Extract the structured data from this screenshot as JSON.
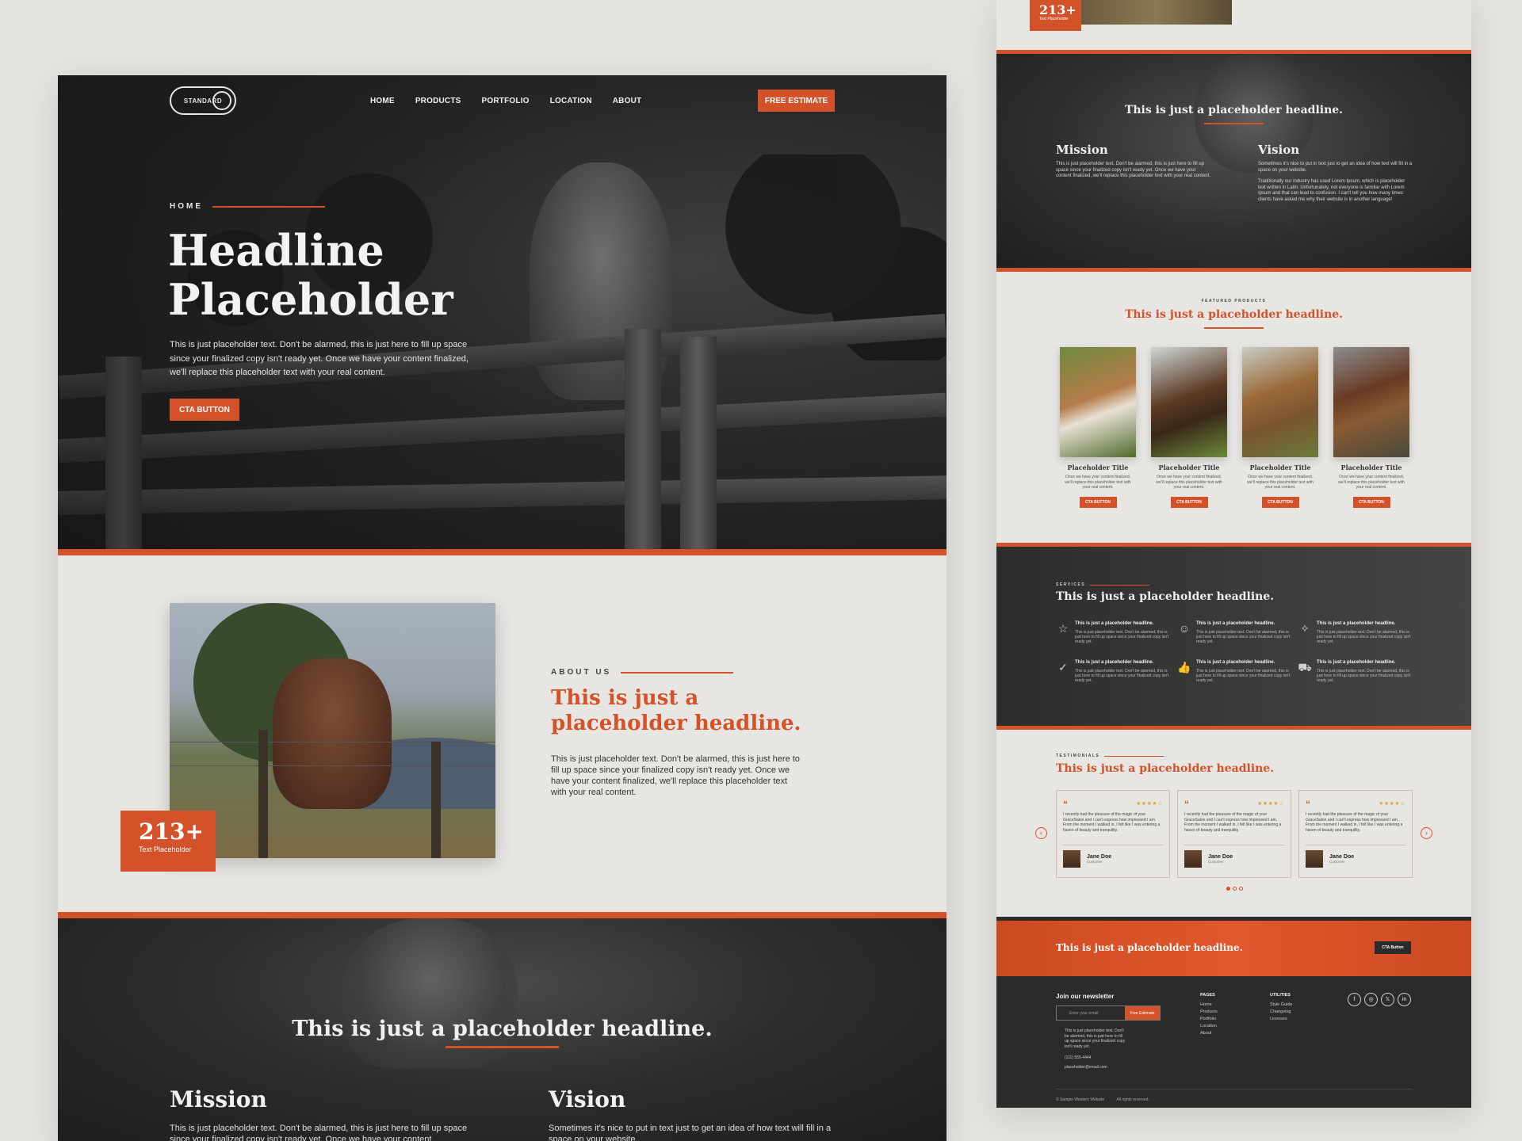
{
  "brand": {
    "logo_text": "STANDARD"
  },
  "nav": {
    "items": [
      "HOME",
      "PRODUCTS",
      "PORTFOLIO",
      "LOCATION",
      "ABOUT"
    ],
    "estimate_label": "FREE ESTIMATE"
  },
  "hero": {
    "eyebrow": "HOME",
    "headline_1": "Headline",
    "headline_2": "Placeholder",
    "body": "This is just placeholder text. Don't be alarmed, this is just here to fill up space since your finalized copy isn't ready yet. Once we have your content finalized, we'll replace this placeholder text with your real content.",
    "cta": "CTA BUTTON"
  },
  "about": {
    "eyebrow": "ABOUT US",
    "headline": "This is just a placeholder headline.",
    "body": "This is just placeholder text. Don't be alarmed, this is just here to fill up space since your finalized copy isn't ready yet. Once we have your content finalized, we'll replace this placeholder text with your real content.",
    "stat_value": "213+",
    "stat_label": "Text Placeholder"
  },
  "mission_vision": {
    "headline": "This is just a placeholder headline.",
    "mission_title": "Mission",
    "mission_text": "This is just placeholder text. Don't be alarmed, this is just here to fill up space since your finalized copy isn't ready yet. Once we have your content",
    "vision_title": "Vision",
    "vision_text": "Sometimes it's nice to put in text just to get an idea of how text will fill in a space on your website."
  },
  "right_page": {
    "stat_value": "213+",
    "stat_label": "Text Placeholder",
    "mv": {
      "headline": "This is just a placeholder headline.",
      "mission_title": "Mission",
      "mission_text": "This is just placeholder text. Don't be alarmed, this is just here to fill up space since your finalized copy isn't ready yet. Once we have your content finalized, we'll replace this placeholder text with your real content.",
      "vision_title": "Vision",
      "vision_text_1": "Sometimes it's nice to put in text just to get an idea of how text will fill in a space on your website.",
      "vision_text_2": "Traditionally our industry has used Lorem Ipsum, which is placeholder text written in Latin. Unfortunately, not everyone is familiar with Lorem Ipsum and that can lead to confusion. I can't tell you how many times clients have asked me why their website is in another language!"
    },
    "products": {
      "eyebrow": "FEATURED PRODUCTS",
      "headline": "This is just a placeholder headline.",
      "cards": [
        {
          "title": "Placeholder Title",
          "text": "Once we have your content finalized, we'll replace this placeholder text with your real content.",
          "button": "CTA BUTTON",
          "image": "pony-photo"
        },
        {
          "title": "Placeholder Title",
          "text": "Once we have your content finalized, we'll replace this placeholder text with your real content.",
          "button": "CTA BUTTON",
          "image": "horse-photo"
        },
        {
          "title": "Placeholder Title",
          "text": "Once we have your content finalized, we'll replace this placeholder text with your real content.",
          "button": "CTA BUTTON",
          "image": "cow-photo"
        },
        {
          "title": "Placeholder Title",
          "text": "Once we have your content finalized, we'll replace this placeholder text with your real content.",
          "button": "CTA BUTTON",
          "image": "calf-photo"
        }
      ]
    },
    "services": {
      "eyebrow": "SERVICES",
      "headline": "This is just a placeholder headline.",
      "items": [
        {
          "icon": "star-icon",
          "glyph": "☆",
          "title": "This is just a placeholder headline.",
          "text": "This is just placeholder text. Don't be alarmed, this is just here to fill up space since your finalized copy isn't ready yet."
        },
        {
          "icon": "users-icon",
          "glyph": "☺",
          "title": "This is just a placeholder headline.",
          "text": "This is just placeholder text. Don't be alarmed, this is just here to fill up space since your finalized copy isn't ready yet."
        },
        {
          "icon": "sparkle-icon",
          "glyph": "✧",
          "title": "This is just a placeholder headline.",
          "text": "This is just placeholder text. Don't be alarmed, this is just here to fill up space since your finalized copy isn't ready yet."
        },
        {
          "icon": "check-badge-icon",
          "glyph": "✓",
          "title": "This is just a placeholder headline.",
          "text": "This is just placeholder text. Don't be alarmed, this is just here to fill up space since your finalized copy isn't ready yet."
        },
        {
          "icon": "thumbs-up-icon",
          "glyph": "👍",
          "title": "This is just a placeholder headline.",
          "text": "This is just placeholder text. Don't be alarmed, this is just here to fill up space since your finalized copy isn't ready yet."
        },
        {
          "icon": "truck-icon",
          "glyph": "⛟",
          "title": "This is just a placeholder headline.",
          "text": "This is just placeholder text. Don't be alarmed, this is just here to fill up space since your finalized copy isn't ready yet."
        }
      ]
    },
    "testimonials": {
      "eyebrow": "TESTIMONIALS",
      "headline": "This is just a placeholder headline.",
      "items": [
        {
          "quote": "I recently had the pleasure of the magic of your GraceSalon and I can't express how impressed I am. From the moment I walked in, I felt like I was entering a haven of beauty and tranquility.",
          "name": "Jane Doe",
          "role": "Customer",
          "rating": 4
        },
        {
          "quote": "I recently had the pleasure of the magic of your GraceSalon and I can't express how impressed I am. From the moment I walked in, I felt like I was entering a haven of beauty and tranquility.",
          "name": "Jane Doe",
          "role": "Customer",
          "rating": 4
        },
        {
          "quote": "I recently had the pleasure of the magic of your GraceSalon and I can't express how impressed I am. From the moment I walked in, I felt like I was entering a haven of beauty and tranquility.",
          "name": "Jane Doe",
          "role": "Customer",
          "rating": 4
        }
      ],
      "stars": "★★★★☆",
      "active_dot": 1
    },
    "cta_band": {
      "headline": "This is just a placeholder headline.",
      "button": "CTA Button"
    },
    "footer": {
      "newsletter_title": "Join our newsletter",
      "email_placeholder": "Enter your email",
      "subscribe": "Free Estimate",
      "address": "This is just placeholder text. Don't be alarmed, this is just here to fill up space since your finalized copy isn't ready yet.",
      "phone": "(111) 555-4444",
      "email": "placeholder@email.com",
      "pages_title": "PAGES",
      "pages": [
        "Home",
        "Products",
        "Portfolio",
        "Location",
        "About"
      ],
      "utilities_title": "UTILITIES",
      "utilities": [
        "Style Guide",
        "Changelog",
        "Licenses"
      ],
      "copyright": "© Sample Western Website",
      "rights": "All rights reserved."
    }
  },
  "colors": {
    "accent": "#d4522a",
    "dark": "#2b2b2b",
    "light_bg": "#e8e6e2"
  }
}
